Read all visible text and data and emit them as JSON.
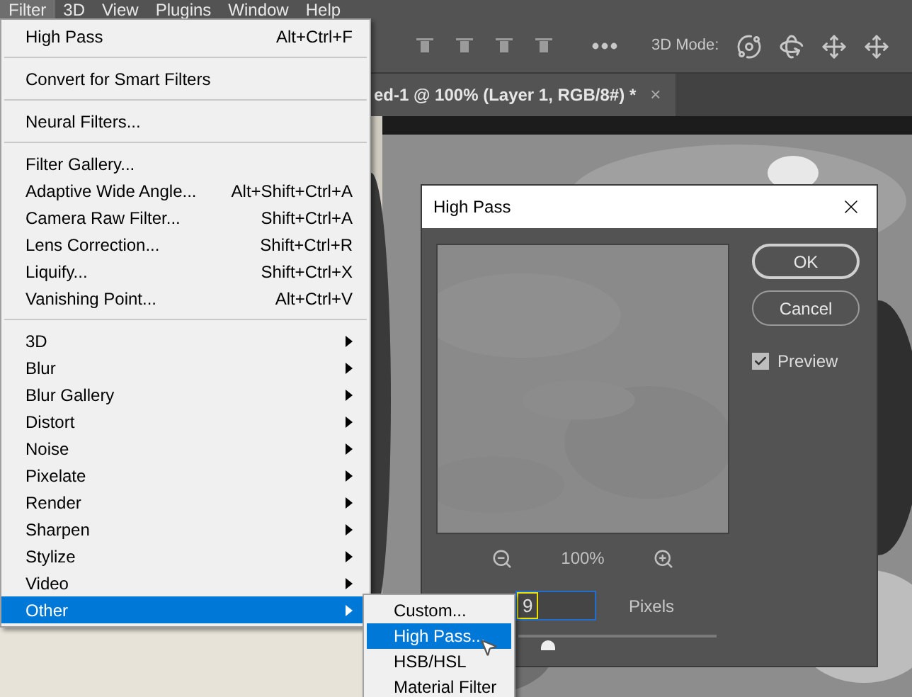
{
  "menubar": [
    {
      "label": "Filter",
      "selected": true
    },
    {
      "label": "3D",
      "selected": false
    },
    {
      "label": "View",
      "selected": false
    },
    {
      "label": "Plugins",
      "selected": false
    },
    {
      "label": "Window",
      "selected": false
    },
    {
      "label": "Help",
      "selected": false
    }
  ],
  "toolbar": {
    "mode_label": "3D Mode:"
  },
  "document_tab": {
    "title": "ed-1 @ 100% (Layer 1, RGB/8#) *",
    "close": "×"
  },
  "filter_menu": [
    {
      "kind": "item",
      "label": "High Pass",
      "shortcut": "Alt+Ctrl+F",
      "selected": false
    },
    {
      "kind": "separator"
    },
    {
      "kind": "item",
      "label": "Convert for Smart Filters",
      "selected": false
    },
    {
      "kind": "separator"
    },
    {
      "kind": "item",
      "label": "Neural Filters...",
      "selected": false
    },
    {
      "kind": "separator"
    },
    {
      "kind": "item",
      "label": "Filter Gallery...",
      "selected": false
    },
    {
      "kind": "item",
      "label": "Adaptive Wide Angle...",
      "shortcut": "Alt+Shift+Ctrl+A",
      "selected": false
    },
    {
      "kind": "item",
      "label": "Camera Raw Filter...",
      "shortcut": "Shift+Ctrl+A",
      "selected": false
    },
    {
      "kind": "item",
      "label": "Lens Correction...",
      "shortcut": "Shift+Ctrl+R",
      "selected": false
    },
    {
      "kind": "item",
      "label": "Liquify...",
      "shortcut": "Shift+Ctrl+X",
      "selected": false
    },
    {
      "kind": "item",
      "label": "Vanishing Point...",
      "shortcut": "Alt+Ctrl+V",
      "selected": false
    },
    {
      "kind": "separator"
    },
    {
      "kind": "submenu",
      "label": "3D",
      "selected": false
    },
    {
      "kind": "submenu",
      "label": "Blur",
      "selected": false
    },
    {
      "kind": "submenu",
      "label": "Blur Gallery",
      "selected": false
    },
    {
      "kind": "submenu",
      "label": "Distort",
      "selected": false
    },
    {
      "kind": "submenu",
      "label": "Noise",
      "selected": false
    },
    {
      "kind": "submenu",
      "label": "Pixelate",
      "selected": false
    },
    {
      "kind": "submenu",
      "label": "Render",
      "selected": false
    },
    {
      "kind": "submenu",
      "label": "Sharpen",
      "selected": false
    },
    {
      "kind": "submenu",
      "label": "Stylize",
      "selected": false
    },
    {
      "kind": "submenu",
      "label": "Video",
      "selected": false
    },
    {
      "kind": "submenu",
      "label": "Other",
      "selected": true
    }
  ],
  "other_submenu": [
    {
      "label": "Custom...",
      "selected": false
    },
    {
      "label": "High Pass...",
      "selected": true
    },
    {
      "label": "HSB/HSL",
      "selected": false
    },
    {
      "label": "Material Filter",
      "selected": false
    }
  ],
  "dialog": {
    "title": "High Pass",
    "zoom": "100%",
    "radius_value": "9",
    "radius_unit": "Pixels",
    "radius_slider": {
      "level": 0.15
    },
    "buttons": [
      "OK",
      "Cancel"
    ],
    "preview": {
      "label": "Preview",
      "checked": true
    }
  }
}
